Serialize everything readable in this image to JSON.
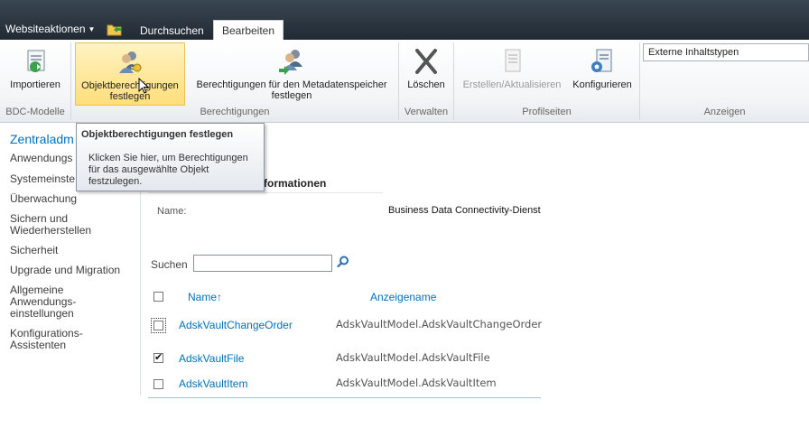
{
  "topbar": {
    "site_actions": "Websiteaktionen",
    "tab_browse": "Durchsuchen",
    "tab_edit": "Bearbeiten"
  },
  "ribbon": {
    "import": "Importieren",
    "set_object_permissions_line1": "Objektberechtigungen",
    "set_object_permissions_line2": "festlegen",
    "set_metadata_permissions_line1": "Berechtigungen für den Metadatenspeicher",
    "set_metadata_permissions_line2": "festlegen",
    "delete": "Löschen",
    "create_update": "Erstellen/Aktualisieren",
    "configure": "Konfigurieren",
    "view_select": "Externe Inhaltstypen",
    "groups": {
      "bdc_models": "BDC-Modelle",
      "permissions": "Berechtigungen",
      "manage": "Verwalten",
      "profile_pages": "Profilseiten",
      "view": "Anzeigen"
    }
  },
  "tooltip": {
    "title": "Objektberechtigungen festlegen",
    "line1": "Klicken Sie hier, um Berechtigungen",
    "line2": "für das ausgewählte Objekt",
    "line3": "festzulegen."
  },
  "nav": {
    "head": "Zentraladm",
    "items": [
      "Anwendungs",
      "Systemeinste",
      "Überwachung",
      "Sichern und",
      "Wiederherstellen",
      "Sicherheit",
      "Upgrade und Migration",
      "Allgemeine",
      "Anwendungs-",
      "einstellungen",
      "Konfigurations-",
      "Assistenten"
    ]
  },
  "main": {
    "info_title": "formationen",
    "name_label": "Name:",
    "name_value": "Business Data Connectivity-Dienst",
    "search_label": "Suchen",
    "col_name": "Name↑",
    "col_display": "Anzeigename",
    "rows": [
      {
        "name": "AdskVaultChangeOrder",
        "display": "AdskVaultModel.AdskVaultChangeOrder",
        "checked": false
      },
      {
        "name": "AdskVaultFile",
        "display": "AdskVaultModel.AdskVaultFile",
        "checked": true
      },
      {
        "name": "AdskVaultItem",
        "display": "AdskVaultModel.AdskVaultItem",
        "checked": false
      }
    ]
  },
  "colors": {
    "topbar": "#2a333d",
    "link": "#0072bc",
    "selected_button": "#ffde7a"
  }
}
